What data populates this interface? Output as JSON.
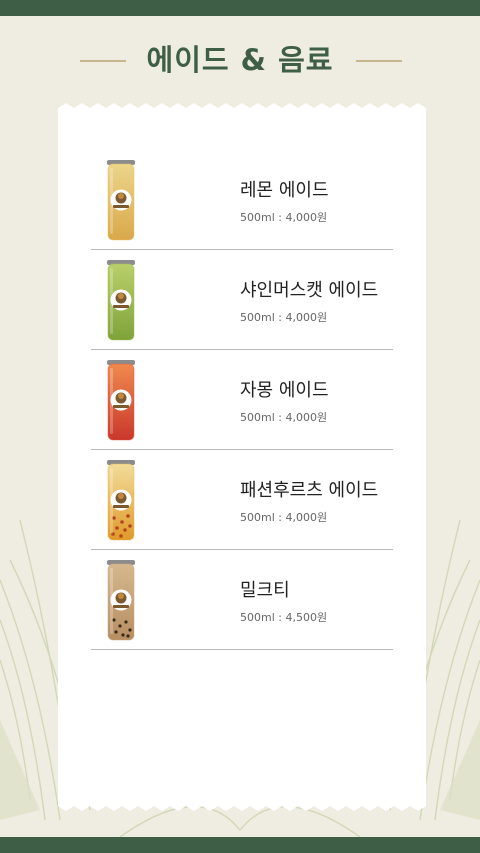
{
  "header": {
    "title": "에이드 & 음료"
  },
  "menu": {
    "items": [
      {
        "name": "레몬 에이드",
        "detail": "500ml : 4,000원",
        "drink": "lemon",
        "color_top": "#ecd58a",
        "color_bottom": "#d9a84a",
        "tint": "#e6c36a"
      },
      {
        "name": "샤인머스캣 에이드",
        "detail": "500ml : 4,000원",
        "drink": "grape",
        "color_top": "#b9cf6a",
        "color_bottom": "#7fa33a",
        "tint": "#9cbc4e"
      },
      {
        "name": "자몽 에이드",
        "detail": "500ml : 4,000원",
        "drink": "grapefruit",
        "color_top": "#f08a4e",
        "color_bottom": "#c9372c",
        "tint": "#e05a3a"
      },
      {
        "name": "패션후르츠 에이드",
        "detail": "500ml : 4,000원",
        "drink": "passionfruit",
        "color_top": "#f2dc9a",
        "color_bottom": "#e09a2a",
        "tint": "#e8b84a"
      },
      {
        "name": "밀크티",
        "detail": "500ml : 4,500원",
        "drink": "milktea",
        "color_top": "#d6b88e",
        "color_bottom": "#b78e62",
        "tint": "#c9a57a"
      }
    ]
  },
  "colors": {
    "bar": "#3e5e45",
    "background": "#efece2",
    "paper": "#ffffff",
    "accent_line": "#c9b58e",
    "leaf": "#d3d9b8"
  }
}
